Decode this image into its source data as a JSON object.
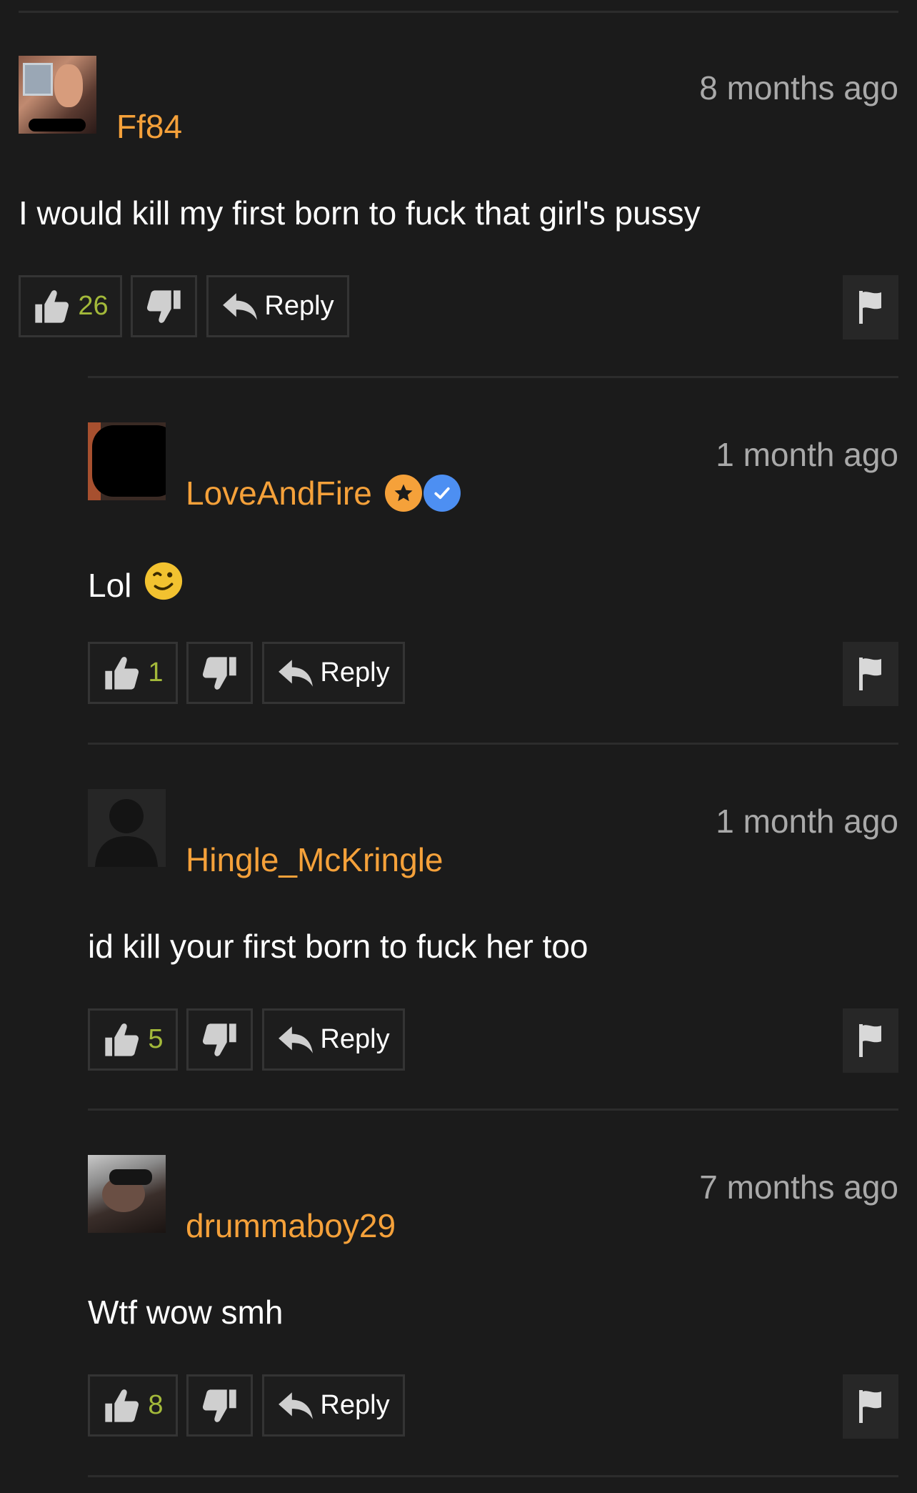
{
  "comments": [
    {
      "username": "Ff84",
      "time": "8 months ago",
      "text": "I would kill my first born to fuck that girl's pussy",
      "likes": "26",
      "reply_label": "Reply"
    },
    {
      "username": "LoveAndFire",
      "time": "1 month ago",
      "text": "Lol",
      "likes": "1",
      "reply_label": "Reply"
    },
    {
      "username": "Hingle_McKringle",
      "time": "1 month ago",
      "text": "id kill your first born to fuck her too",
      "likes": "5",
      "reply_label": "Reply"
    },
    {
      "username": "drummaboy29",
      "time": "7 months ago",
      "text": "Wtf wow smh",
      "likes": "8",
      "reply_label": "Reply"
    }
  ],
  "colors": {
    "background": "#1b1b1b",
    "username": "#f5a13a",
    "timestamp": "#a9a9a9",
    "like_count": "#a3b93a",
    "star_badge": "#f5a13a",
    "verified_badge": "#4d8ff2"
  },
  "icons": [
    "thumbs-up-icon",
    "thumbs-down-icon",
    "reply-arrow-icon",
    "flag-icon",
    "star-badge-icon",
    "verified-badge-icon",
    "winking-emoji-icon"
  ]
}
